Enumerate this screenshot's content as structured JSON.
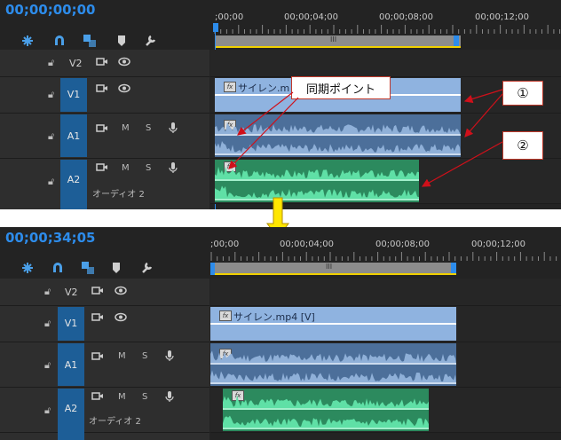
{
  "top": {
    "timecode": "00;00;00;00",
    "ruler": [
      ";00;00",
      "00;00;04;00",
      "00;00;08;00",
      "00;00;12;00"
    ],
    "tracks": {
      "v2": "V2",
      "v1": "V1",
      "a1": "A1",
      "a2": "A2",
      "a2_name": "オーディオ 2",
      "m": "M",
      "s": "S"
    },
    "clip_v_label": "サイレン.m",
    "callout_sync": "同期ポイント",
    "callout_1": "①",
    "callout_2": "②"
  },
  "bottom": {
    "timecode": "00;00;34;05",
    "ruler": [
      ";00;00",
      "00;00;04;00",
      "00;00;08;00",
      "00;00;12;00"
    ],
    "tracks": {
      "v2": "V2",
      "v1": "V1",
      "a1": "A1",
      "a2": "A2",
      "a2_name": "オーディオ 2",
      "m": "M",
      "s": "S"
    },
    "clip_v_label": "サイレン.mp4 [V]"
  },
  "fx_label": "fx",
  "icons": [
    "snap-icon",
    "magnet-icon",
    "linked-selection-icon",
    "marker-icon",
    "wrench-icon",
    "lock-icon",
    "camera-icon",
    "eye-icon",
    "mic-icon",
    "arrow-down-icon"
  ],
  "colors": {
    "timecode": "#2d8ceb",
    "video_clip": "#8fb3e0",
    "audio_clip_a1": "#4c6f9a",
    "audio_clip_a2": "#2c8a5e",
    "target_track": "#1d5e97",
    "arrow_red": "#d0101a",
    "arrow_yellow": "#ffe600"
  }
}
